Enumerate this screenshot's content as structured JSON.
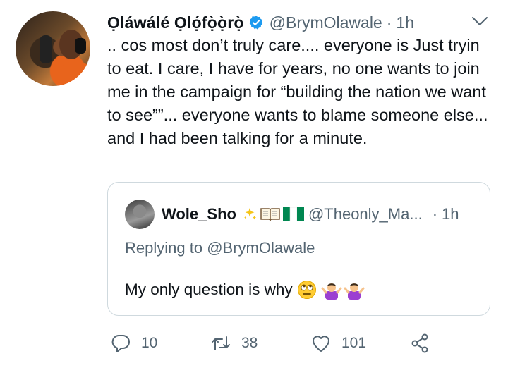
{
  "author": {
    "name": "Ọláwálé Ọlọ́fọ̀ọ̀rọ̀",
    "handle": "@BrymOlawale",
    "separator": "·",
    "time": "1h"
  },
  "tweet_text": ".. cos most don’t truly care.... everyone is Just tryin to eat. I care, I have for years, no one wants to join me in the campaign for “building the nation we want to see””... everyone wants to blame someone else... and I had been talking for a minute.",
  "quoted_tweet": {
    "name": "Wole_Sho",
    "handle": "@Theonly_Ma...",
    "separator": "·",
    "time": "1h",
    "replying_to_label": "Replying to",
    "replying_to_handle": "@BrymOlawale",
    "text": "My only question is why",
    "name_emojis": [
      "sparkles-icon",
      "open-book-icon",
      "nigeria-flag-icon"
    ],
    "text_emojis": [
      "face-with-rolling-eyes-icon",
      "person-shrugging-icon",
      "person-shrugging-icon"
    ]
  },
  "actions": {
    "reply_count": "10",
    "retweet_count": "38",
    "like_count": "101"
  },
  "colors": {
    "verified": "#1d9bf0",
    "secondary_text": "#536471",
    "border": "#cfd9de"
  }
}
